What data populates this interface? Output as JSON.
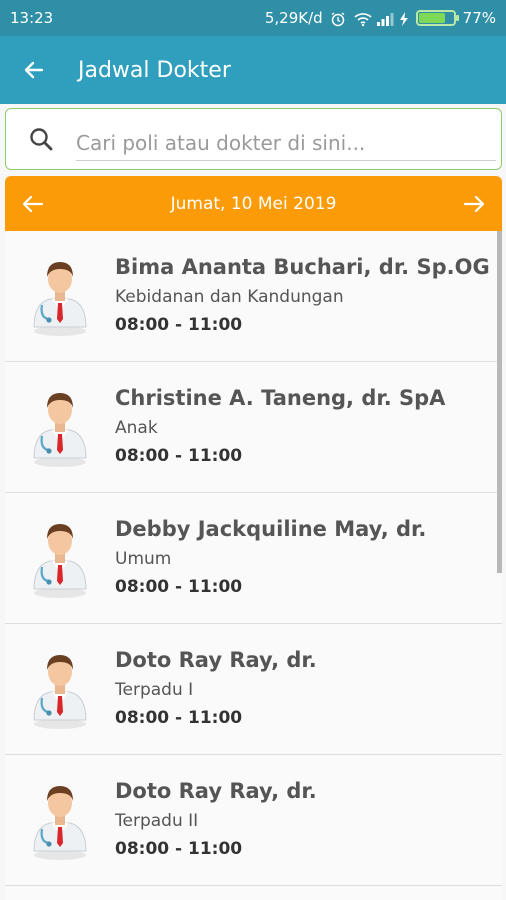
{
  "status": {
    "time": "13:23",
    "network_speed": "5,29K/d",
    "battery_percent": "77%",
    "battery_level": 0.77,
    "icons": [
      "alarm-icon",
      "wifi-icon",
      "signal-icon",
      "charging-icon",
      "battery-icon"
    ]
  },
  "app_bar": {
    "title": "Jadwal Dokter",
    "back_icon": "arrow-left-icon"
  },
  "search": {
    "placeholder": "Cari poli atau dokter di sini...",
    "value": ""
  },
  "date_nav": {
    "label": "Jumat, 10 Mei 2019",
    "prev_icon": "arrow-left-icon",
    "next_icon": "arrow-right-icon"
  },
  "colors": {
    "app_bar": "#2f9fbd",
    "status_bar": "#2f8fa6",
    "date_bar": "#fc9b08",
    "search_border": "#8fcd6a"
  },
  "doctors": [
    {
      "name": "Bima Ananta Buchari, dr. Sp.OG",
      "specialty": "Kebidanan dan Kandungan",
      "time": "08:00 - 11:00"
    },
    {
      "name": "Christine A. Taneng, dr. SpA",
      "specialty": "Anak",
      "time": "08:00 - 11:00"
    },
    {
      "name": "Debby Jackquiline May, dr.",
      "specialty": "Umum",
      "time": "08:00 - 11:00"
    },
    {
      "name": "Doto Ray Ray, dr.",
      "specialty": "Terpadu I",
      "time": "08:00 - 11:00"
    },
    {
      "name": "Doto Ray Ray, dr.",
      "specialty": "Terpadu II",
      "time": "08:00 - 11:00"
    }
  ]
}
